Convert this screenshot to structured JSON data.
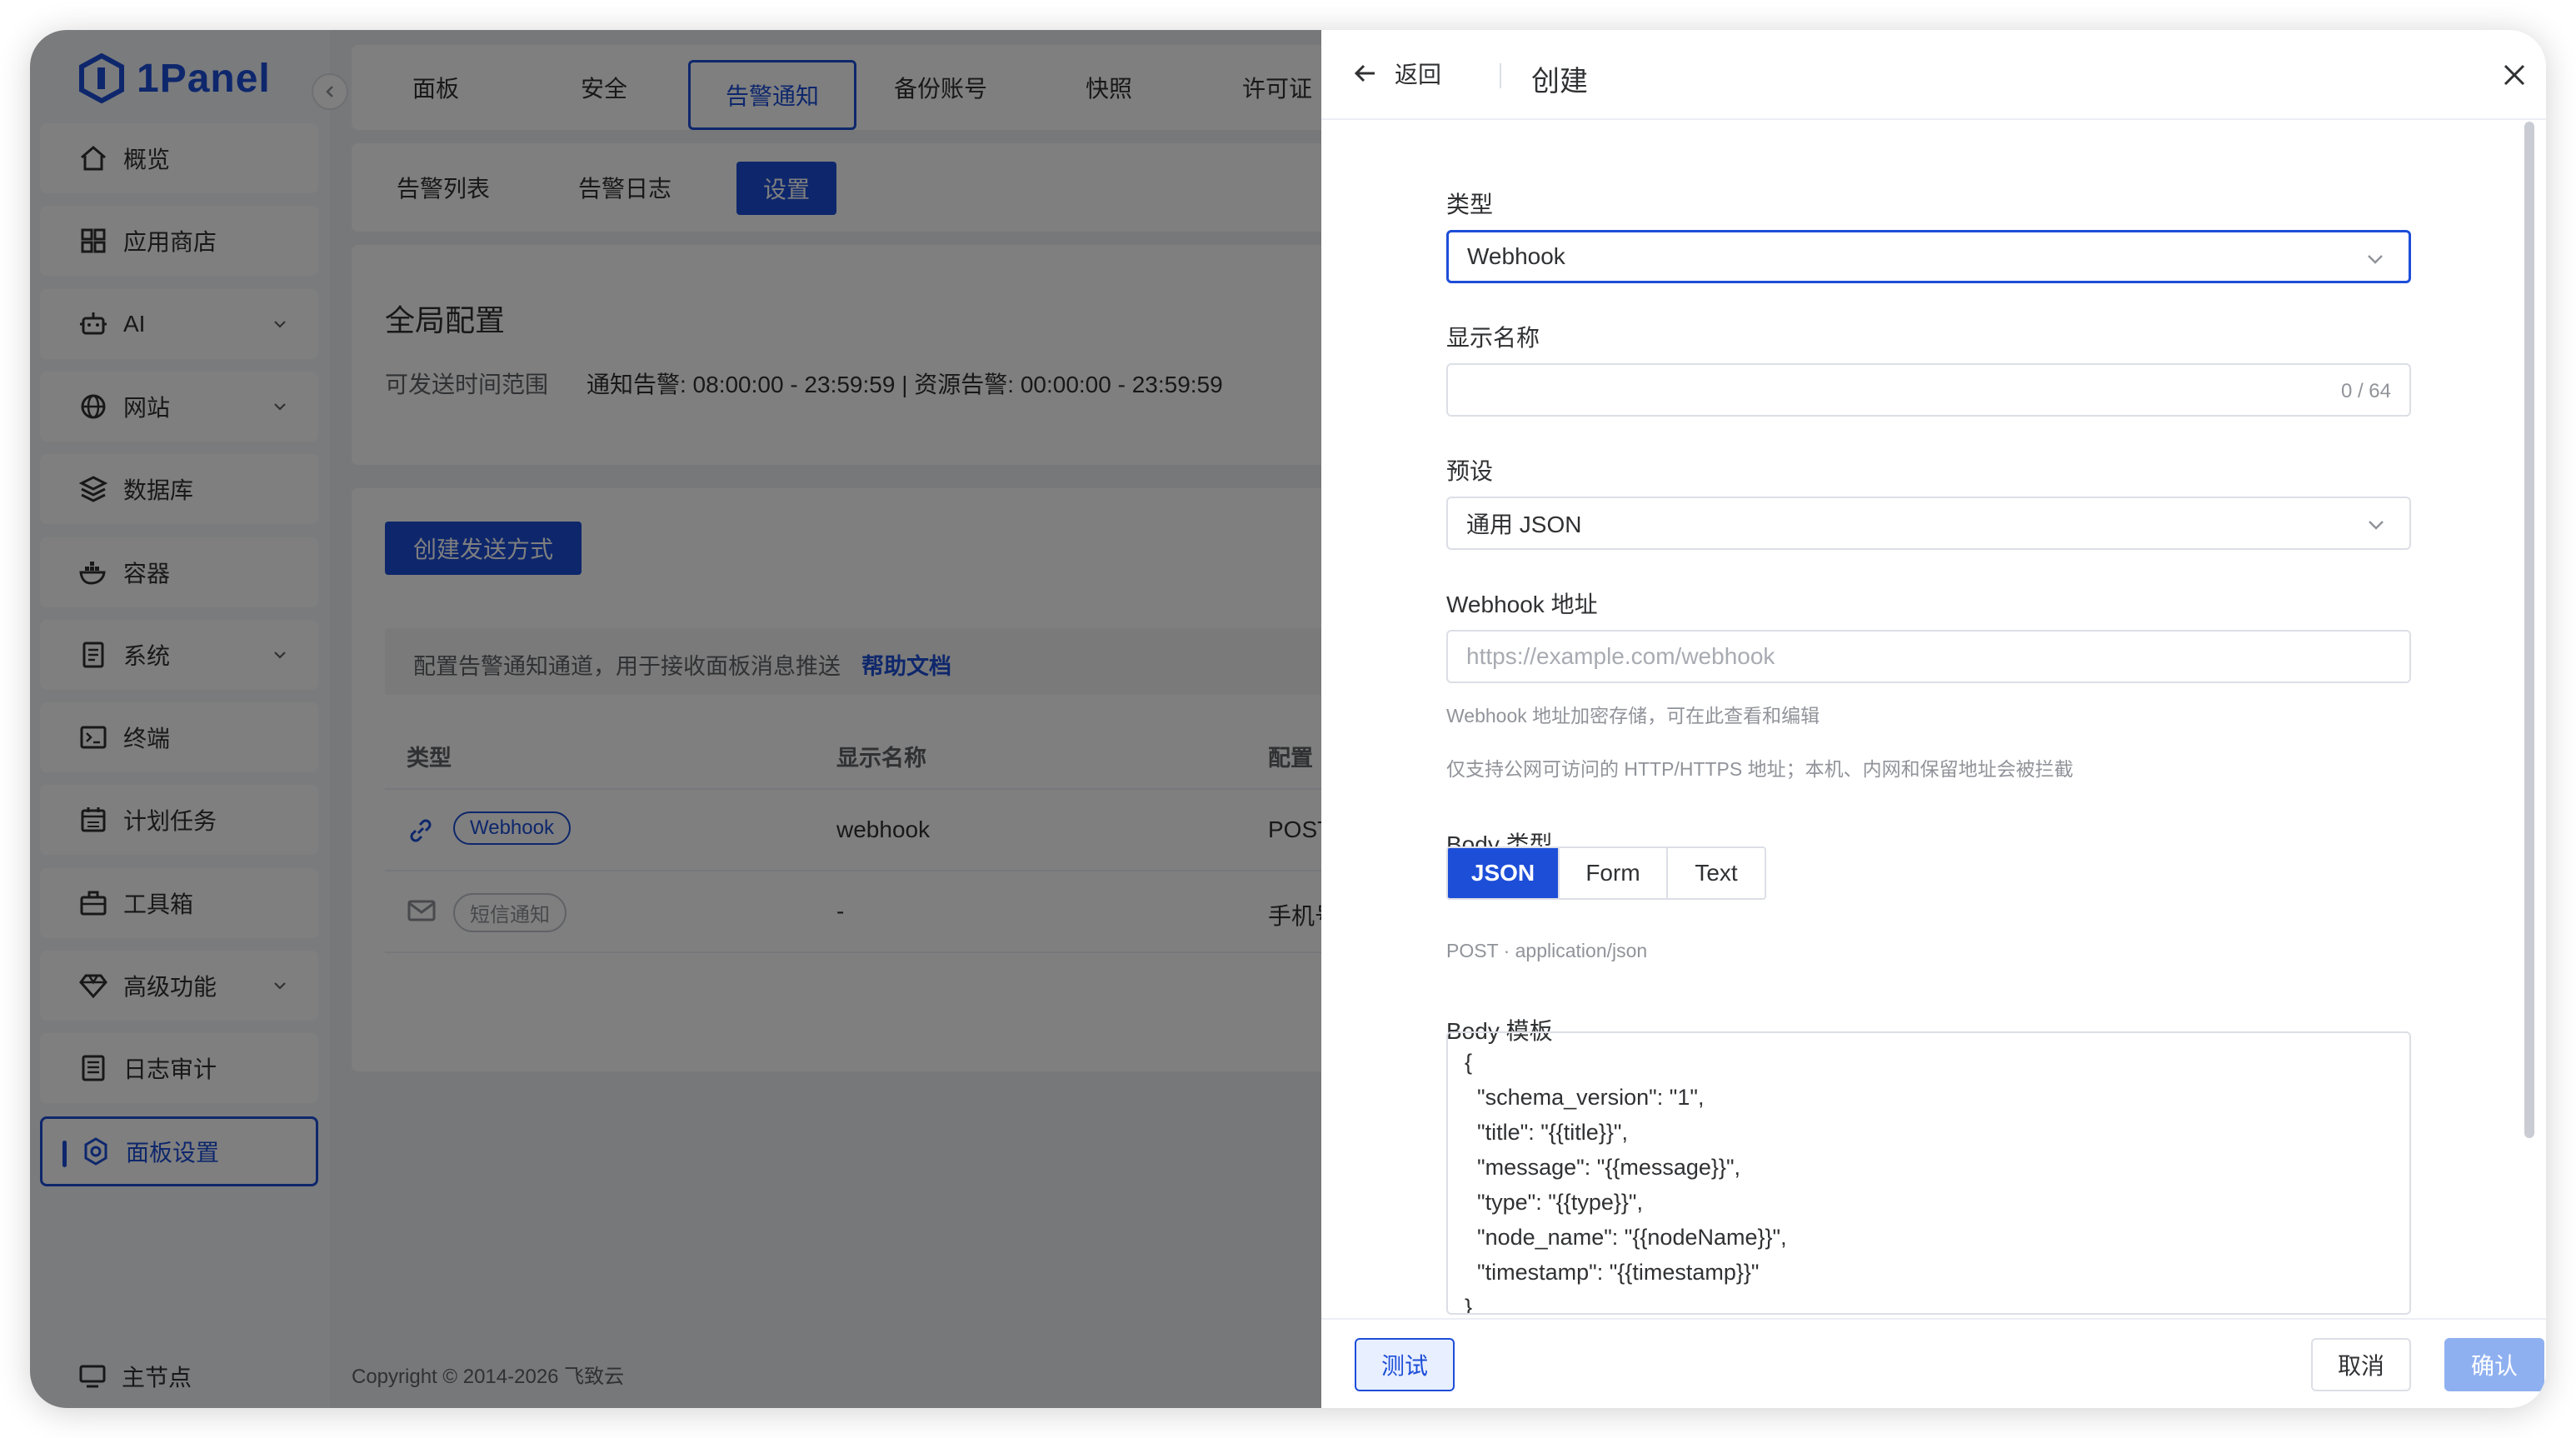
{
  "app": {
    "logo_text": "1Panel"
  },
  "sidebar": {
    "items": [
      {
        "label": "概览",
        "icon": "home-icon",
        "expandable": false
      },
      {
        "label": "应用商店",
        "icon": "apps-grid-icon",
        "expandable": false
      },
      {
        "label": "AI",
        "icon": "robot-icon",
        "expandable": true
      },
      {
        "label": "网站",
        "icon": "globe-icon",
        "expandable": true
      },
      {
        "label": "数据库",
        "icon": "layers-icon",
        "expandable": false
      },
      {
        "label": "容器",
        "icon": "docker-icon",
        "expandable": false
      },
      {
        "label": "系统",
        "icon": "document-icon",
        "expandable": true
      },
      {
        "label": "终端",
        "icon": "terminal-icon",
        "expandable": false
      },
      {
        "label": "计划任务",
        "icon": "calendar-icon",
        "expandable": false
      },
      {
        "label": "工具箱",
        "icon": "toolbox-icon",
        "expandable": false
      },
      {
        "label": "高级功能",
        "icon": "diamond-icon",
        "expandable": true
      },
      {
        "label": "日志审计",
        "icon": "log-icon",
        "expandable": false
      },
      {
        "label": "面板设置",
        "icon": "settings-icon",
        "expandable": false,
        "active": true
      }
    ],
    "bottom_label": "主节点"
  },
  "top_tabs": [
    "面板",
    "安全",
    "告警通知",
    "备份账号",
    "快照",
    "许可证"
  ],
  "top_tabs_active": "告警通知",
  "sub_tabs": [
    "告警列表",
    "告警日志",
    "设置"
  ],
  "sub_tabs_active": "设置",
  "global_config": {
    "title": "全局配置",
    "time_range_label": "可发送时间范围",
    "time_range_value": "通知告警: 08:00:00 - 23:59:59 | 资源告警: 00:00:00 - 23:59:59"
  },
  "channels": {
    "create_button": "创建发送方式",
    "info_text": "配置告警通知通道，用于接收面板消息推送",
    "help_link": "帮助文档",
    "columns": [
      "类型",
      "显示名称",
      "配置"
    ],
    "rows": [
      {
        "icon": "link-icon",
        "type": "Webhook",
        "name": "webhook",
        "config": "POST"
      },
      {
        "icon": "mail-icon",
        "type": "短信通知",
        "name": "-",
        "config": "手机号"
      }
    ]
  },
  "footer": {
    "copyright": "Copyright © 2014-2026 飞致云"
  },
  "drawer": {
    "back_label": "返回",
    "title": "创建",
    "type_label": "类型",
    "type_value": "Webhook",
    "display_name_label": "显示名称",
    "display_name_value": "",
    "display_name_count": "0 / 64",
    "preset_label": "预设",
    "preset_value": "通用 JSON",
    "webhook_url_label": "Webhook 地址",
    "webhook_url_placeholder": "https://example.com/webhook",
    "webhook_hint_1": "Webhook 地址加密存储，可在此查看和编辑",
    "webhook_hint_2": "仅支持公网可访问的 HTTP/HTTPS 地址；本机、内网和保留地址会被拦截",
    "body_type_label": "Body 类型",
    "body_type_options": [
      "JSON",
      "Form",
      "Text"
    ],
    "body_type_active": "JSON",
    "body_type_hint": "POST · application/json",
    "body_template_label": "Body 模板",
    "body_template_lines": [
      "{",
      "  \"schema_version\": \"1\",",
      "  \"title\": \"{{title}}\",",
      "  \"message\": \"{{message}}\",",
      "  \"type\": \"{{type}}\",",
      "  \"node_name\": \"{{nodeName}}\",",
      "  \"timestamp\": \"{{timestamp}}\"",
      "}"
    ],
    "test_button": "测试",
    "cancel_button": "取消",
    "confirm_button": "确认"
  },
  "colors": {
    "accent": "#1d4ed8",
    "confirm_disabled": "#8fb0f0"
  }
}
